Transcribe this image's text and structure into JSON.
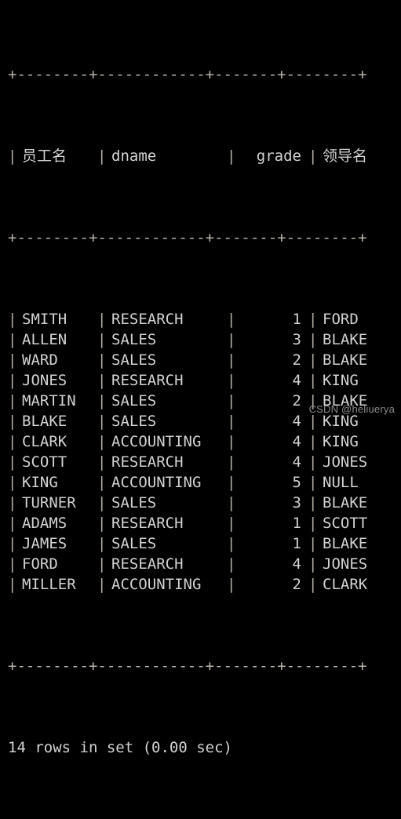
{
  "terminal": {
    "background_color": "#000000",
    "text_color": "#d2d2d2",
    "border_color": "#b3aea6"
  },
  "table": {
    "top_rule": "+--------+------------+-------+--------+",
    "header_rule": "+--------+------------+-------+--------+",
    "bottom_rule": "+--------+------------+-------+--------+",
    "columns": [
      {
        "key": "emp_name",
        "label": "员工名",
        "align": "left"
      },
      {
        "key": "dname",
        "label": "dname",
        "align": "left"
      },
      {
        "key": "grade",
        "label": "grade",
        "align": "right"
      },
      {
        "key": "mgr_name",
        "label": "领导名",
        "align": "left"
      }
    ],
    "rows": [
      {
        "emp_name": "SMITH",
        "dname": "RESEARCH",
        "grade": "1",
        "mgr_name": "FORD"
      },
      {
        "emp_name": "ALLEN",
        "dname": "SALES",
        "grade": "3",
        "mgr_name": "BLAKE"
      },
      {
        "emp_name": "WARD",
        "dname": "SALES",
        "grade": "2",
        "mgr_name": "BLAKE"
      },
      {
        "emp_name": "JONES",
        "dname": "RESEARCH",
        "grade": "4",
        "mgr_name": "KING"
      },
      {
        "emp_name": "MARTIN",
        "dname": "SALES",
        "grade": "2",
        "mgr_name": "BLAKE"
      },
      {
        "emp_name": "BLAKE",
        "dname": "SALES",
        "grade": "4",
        "mgr_name": "KING"
      },
      {
        "emp_name": "CLARK",
        "dname": "ACCOUNTING",
        "grade": "4",
        "mgr_name": "KING"
      },
      {
        "emp_name": "SCOTT",
        "dname": "RESEARCH",
        "grade": "4",
        "mgr_name": "JONES"
      },
      {
        "emp_name": "KING",
        "dname": "ACCOUNTING",
        "grade": "5",
        "mgr_name": "NULL"
      },
      {
        "emp_name": "TURNER",
        "dname": "SALES",
        "grade": "3",
        "mgr_name": "BLAKE"
      },
      {
        "emp_name": "ADAMS",
        "dname": "RESEARCH",
        "grade": "1",
        "mgr_name": "SCOTT"
      },
      {
        "emp_name": "JAMES",
        "dname": "SALES",
        "grade": "1",
        "mgr_name": "BLAKE"
      },
      {
        "emp_name": "FORD",
        "dname": "RESEARCH",
        "grade": "4",
        "mgr_name": "JONES"
      },
      {
        "emp_name": "MILLER",
        "dname": "ACCOUNTING",
        "grade": "2",
        "mgr_name": "CLARK"
      }
    ]
  },
  "status_line": "14 rows in set (0.00 sec)",
  "watermark": "CSDN @heliuerya"
}
